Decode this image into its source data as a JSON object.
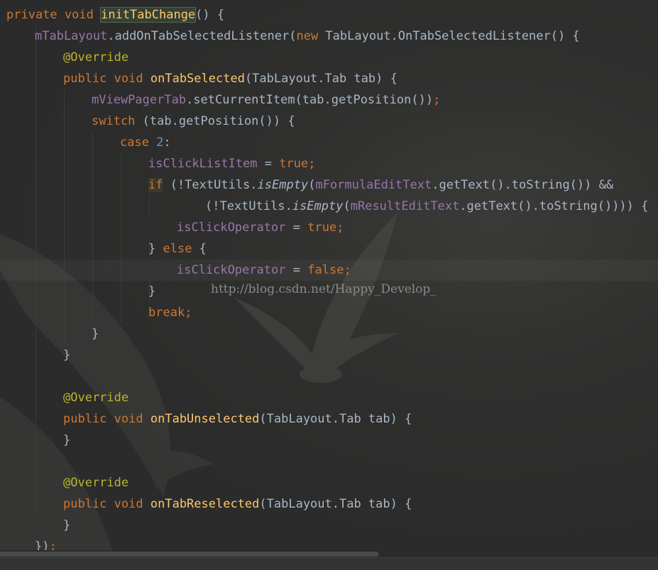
{
  "editor": {
    "lines": [
      {
        "indent": 0,
        "tokens": [
          {
            "t": "private",
            "c": "kw"
          },
          {
            "t": " "
          },
          {
            "t": "void",
            "c": "kw"
          },
          {
            "t": " "
          },
          {
            "t": "initTabChange",
            "c": "fn hl"
          },
          {
            "t": "() {"
          }
        ]
      },
      {
        "indent": 1,
        "tokens": [
          {
            "t": "mTabLayout",
            "c": "field"
          },
          {
            "t": ".addOnTabSelectedListener("
          },
          {
            "t": "new",
            "c": "kw"
          },
          {
            "t": " TabLayout.OnTabSelectedListener() {"
          }
        ]
      },
      {
        "indent": 2,
        "tokens": [
          {
            "t": "@Override",
            "c": "ann"
          }
        ]
      },
      {
        "indent": 2,
        "tokens": [
          {
            "t": "public",
            "c": "kw"
          },
          {
            "t": " "
          },
          {
            "t": "void",
            "c": "kw"
          },
          {
            "t": " "
          },
          {
            "t": "onTabSelected",
            "c": "fn"
          },
          {
            "t": "(TabLayout.Tab tab) {"
          }
        ]
      },
      {
        "indent": 3,
        "tokens": [
          {
            "t": "mViewPagerTab",
            "c": "field"
          },
          {
            "t": ".setCurrentItem(tab.getPosition())"
          },
          {
            "t": ";",
            "c": "kw"
          }
        ]
      },
      {
        "indent": 3,
        "tokens": [
          {
            "t": "switch",
            "c": "kw"
          },
          {
            "t": " (tab.getPosition()) {"
          }
        ]
      },
      {
        "indent": 4,
        "tokens": [
          {
            "t": "case",
            "c": "kw"
          },
          {
            "t": " "
          },
          {
            "t": "2",
            "c": "num"
          },
          {
            "t": ":"
          }
        ]
      },
      {
        "indent": 5,
        "tokens": [
          {
            "t": "isClickListItem",
            "c": "field"
          },
          {
            "t": " = "
          },
          {
            "t": "true",
            "c": "kw"
          },
          {
            "t": ";",
            "c": "kw"
          }
        ]
      },
      {
        "indent": 5,
        "tokens": [
          {
            "t": "if",
            "c": "kw ifhl"
          },
          {
            "t": " (!TextUtils."
          },
          {
            "t": "isEmpty",
            "c": "it"
          },
          {
            "t": "("
          },
          {
            "t": "mFormulaEditText",
            "c": "field"
          },
          {
            "t": ".getText().toString()) &&"
          }
        ]
      },
      {
        "indent": 7,
        "tokens": [
          {
            "t": "(!TextUtils."
          },
          {
            "t": "isEmpty",
            "c": "it"
          },
          {
            "t": "("
          },
          {
            "t": "mResultEditText",
            "c": "field"
          },
          {
            "t": ".getText().toString()))) {"
          }
        ]
      },
      {
        "indent": 6,
        "tokens": [
          {
            "t": "isClickOperator",
            "c": "field"
          },
          {
            "t": " = "
          },
          {
            "t": "true",
            "c": "kw"
          },
          {
            "t": ";",
            "c": "kw"
          }
        ]
      },
      {
        "indent": 5,
        "tokens": [
          {
            "t": "} "
          },
          {
            "t": "else",
            "c": "kw"
          },
          {
            "t": " {"
          }
        ]
      },
      {
        "indent": 6,
        "tokens": [
          {
            "t": "isClickOperator",
            "c": "field"
          },
          {
            "t": " = "
          },
          {
            "t": "false",
            "c": "kw"
          },
          {
            "t": ";",
            "c": "kw"
          }
        ],
        "current": true
      },
      {
        "indent": 5,
        "tokens": [
          {
            "t": "}"
          }
        ]
      },
      {
        "indent": 5,
        "tokens": [
          {
            "t": "break",
            "c": "kw"
          },
          {
            "t": ";",
            "c": "kw"
          }
        ]
      },
      {
        "indent": 3,
        "tokens": [
          {
            "t": "}"
          }
        ]
      },
      {
        "indent": 2,
        "tokens": [
          {
            "t": "}"
          }
        ]
      },
      {
        "indent": 0,
        "tokens": []
      },
      {
        "indent": 2,
        "tokens": [
          {
            "t": "@Override",
            "c": "ann"
          }
        ]
      },
      {
        "indent": 2,
        "tokens": [
          {
            "t": "public",
            "c": "kw"
          },
          {
            "t": " "
          },
          {
            "t": "void",
            "c": "kw"
          },
          {
            "t": " "
          },
          {
            "t": "onTabUnselected",
            "c": "fn"
          },
          {
            "t": "(TabLayout.Tab tab) {"
          }
        ]
      },
      {
        "indent": 2,
        "tokens": [
          {
            "t": "}"
          }
        ]
      },
      {
        "indent": 0,
        "tokens": []
      },
      {
        "indent": 2,
        "tokens": [
          {
            "t": "@Override",
            "c": "ann"
          }
        ]
      },
      {
        "indent": 2,
        "tokens": [
          {
            "t": "public",
            "c": "kw"
          },
          {
            "t": " "
          },
          {
            "t": "void",
            "c": "kw"
          },
          {
            "t": " "
          },
          {
            "t": "onTabReselected",
            "c": "fn"
          },
          {
            "t": "(TabLayout.Tab tab) {"
          }
        ]
      },
      {
        "indent": 2,
        "tokens": [
          {
            "t": "}"
          }
        ]
      },
      {
        "indent": 1,
        "tokens": [
          {
            "t": "})"
          },
          {
            "t": ";",
            "c": "kw"
          }
        ]
      }
    ]
  },
  "watermark": "http://blog.csdn.net/Happy_Develop_",
  "colors": {
    "background": "#2b2b2b",
    "keyword": "#cc7832",
    "method": "#ffc66d",
    "field": "#9876aa",
    "annotation": "#bbb529",
    "number": "#6897bb",
    "text": "#a9b7c6"
  }
}
